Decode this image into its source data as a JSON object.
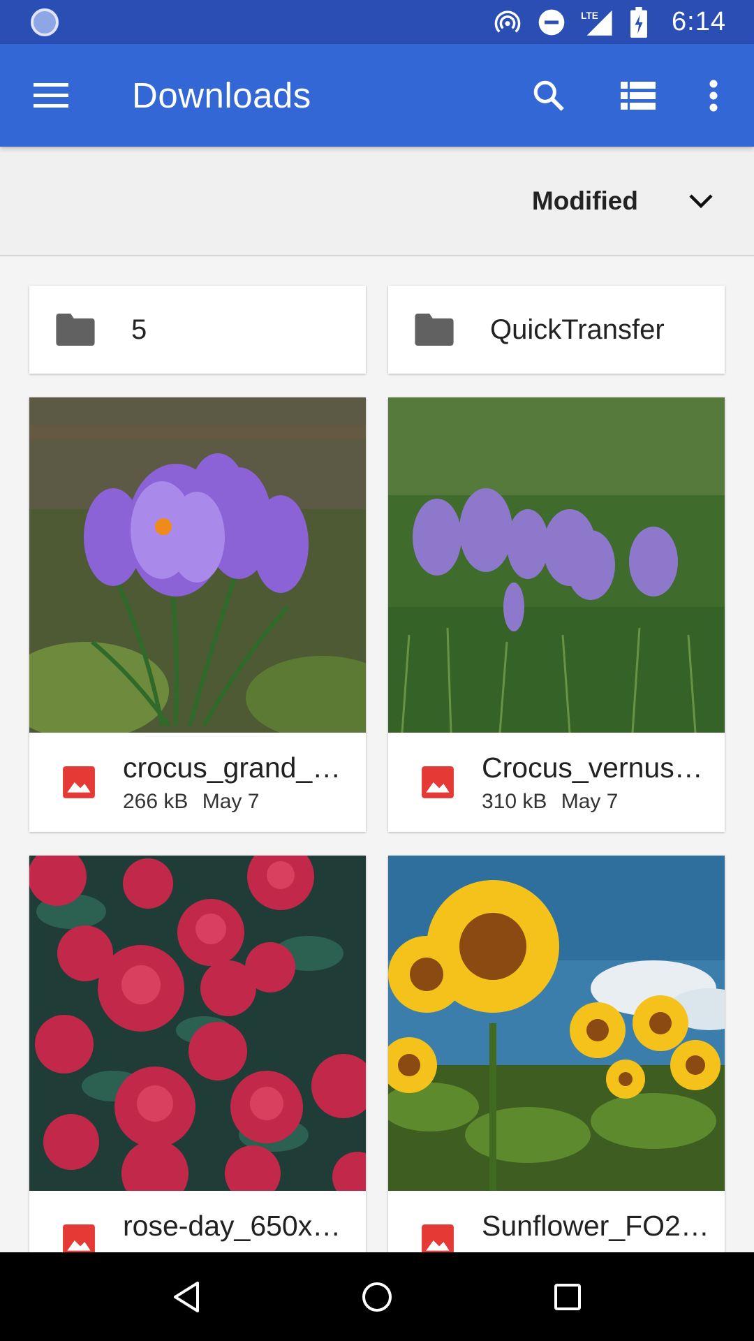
{
  "status_bar": {
    "time": "6:14",
    "network_label": "LTE",
    "icons": [
      "sync-icon",
      "hotspot-icon",
      "do-not-disturb-icon",
      "lte-signal-icon",
      "battery-charging-icon"
    ]
  },
  "app_bar": {
    "title": "Downloads",
    "icons": [
      "menu-icon",
      "search-icon",
      "list-view-icon",
      "more-vert-icon"
    ]
  },
  "sort": {
    "label": "Modified",
    "icon": "chevron-down-icon"
  },
  "folders": [
    {
      "name": "5",
      "icon": "folder-icon"
    },
    {
      "name": "QuickTransfer",
      "icon": "folder-icon"
    }
  ],
  "files": [
    {
      "name": "crocus_grand_…",
      "size": "266 kB",
      "date": "May 7",
      "icon": "image-file-icon",
      "thumb": "purple crocus"
    },
    {
      "name": "Crocus_vernus…",
      "size": "310 kB",
      "date": "May 7",
      "icon": "image-file-icon",
      "thumb": "crocus field"
    },
    {
      "name": "rose-day_650x…",
      "size": "",
      "date": "",
      "icon": "image-file-icon",
      "thumb": "red roses"
    },
    {
      "name": "Sunflower_FO2…",
      "size": "",
      "date": "",
      "icon": "image-file-icon",
      "thumb": "sunflowers"
    }
  ],
  "colors": {
    "status_bar": "#2a4eb4",
    "app_bar": "#3367d6",
    "file_icon": "#e53935",
    "folder_icon": "#616161"
  },
  "nav_bar": {
    "icons": [
      "back-icon",
      "home-icon",
      "recents-icon"
    ]
  }
}
